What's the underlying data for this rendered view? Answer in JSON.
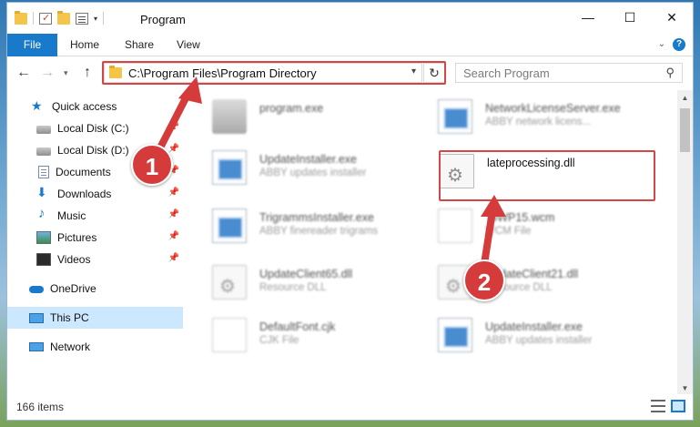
{
  "window": {
    "title": "Program",
    "controls": {
      "minimize": "—",
      "maximize": "☐",
      "close": "✕"
    }
  },
  "ribbon": {
    "tabs": [
      "File",
      "Home",
      "Share",
      "View"
    ]
  },
  "nav": {
    "address": "C:\\Program Files\\Program Directory",
    "search_placeholder": "Search Program"
  },
  "sidebar": {
    "items": [
      {
        "label": "Quick access",
        "icon": "star-icon",
        "pinned": false
      },
      {
        "label": "Local Disk (C:)",
        "icon": "drive-icon",
        "pinned": true
      },
      {
        "label": "Local Disk (D:)",
        "icon": "drive-icon",
        "pinned": true
      },
      {
        "label": "Documents",
        "icon": "documents-icon",
        "pinned": true
      },
      {
        "label": "Downloads",
        "icon": "downloads-icon",
        "pinned": true
      },
      {
        "label": "Music",
        "icon": "music-icon",
        "pinned": true
      },
      {
        "label": "Pictures",
        "icon": "pictures-icon",
        "pinned": true
      },
      {
        "label": "Videos",
        "icon": "videos-icon",
        "pinned": true
      },
      {
        "label": "OneDrive",
        "icon": "onedrive-icon",
        "pinned": false
      },
      {
        "label": "This PC",
        "icon": "pc-icon",
        "pinned": false,
        "selected": true
      },
      {
        "label": "Network",
        "icon": "network-icon",
        "pinned": false
      }
    ]
  },
  "files": [
    {
      "name": "program.exe",
      "desc": "",
      "icon": "exe-icon",
      "blurred": true
    },
    {
      "name": "NetworkLicenseServer.exe",
      "desc": "ABBY network licens...",
      "icon": "app-icon",
      "blurred": true
    },
    {
      "name": "UpdateInstaller.exe",
      "desc": "ABBY updates installer",
      "icon": "app-icon",
      "blurred": true
    },
    {
      "name": "lateprocessing.dll",
      "desc": "",
      "icon": "dll-icon",
      "blurred": false
    },
    {
      "name": "TrigrammsInstaller.exe",
      "desc": "ABBY finereader trigrams",
      "icon": "app-icon",
      "blurred": true
    },
    {
      "name": "ToWP15.wcm",
      "desc": "WCM File",
      "icon": "doc-icon",
      "blurred": true
    },
    {
      "name": "UpdateClient65.dll",
      "desc": "Resource DLL",
      "icon": "dll-icon",
      "blurred": true
    },
    {
      "name": "UpdateClient21.dll",
      "desc": "Resource DLL",
      "icon": "dll-icon",
      "blurred": true
    },
    {
      "name": "DefaultFont.cjk",
      "desc": "CJK File",
      "icon": "doc-icon",
      "blurred": true
    },
    {
      "name": "UpdateInstaller.exe",
      "desc": "ABBY updates installer",
      "icon": "app-icon",
      "blurred": true
    }
  ],
  "status": {
    "item_count": "166 items"
  },
  "annotations": {
    "badge1": "1",
    "badge2": "2",
    "color": "#d63b3b"
  }
}
